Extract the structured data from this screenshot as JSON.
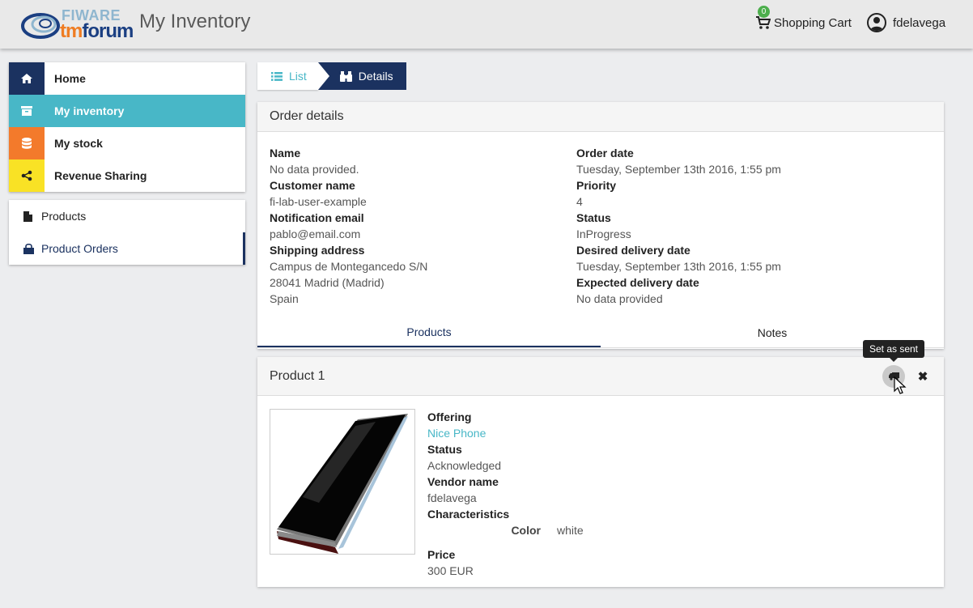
{
  "header": {
    "logo_line1": "FIWARE",
    "logo_line2_a": "tm",
    "logo_line2_b": "forum",
    "app_title": "My Inventory",
    "cart_label": "Shopping Cart",
    "cart_count": "0",
    "username": "fdelavega"
  },
  "sidebar": {
    "items": [
      {
        "label": "Home",
        "icon": "home-icon",
        "color": "#1b3260"
      },
      {
        "label": "My inventory",
        "icon": "archive-icon",
        "color": "#48b7c7"
      },
      {
        "label": "My stock",
        "icon": "database-icon",
        "color": "#f37a2b"
      },
      {
        "label": "Revenue Sharing",
        "icon": "share-icon",
        "color": "#f9e225"
      }
    ],
    "subitems": [
      {
        "label": "Products",
        "icon": "file-icon"
      },
      {
        "label": "Product Orders",
        "icon": "shopping-bag-icon"
      }
    ]
  },
  "breadcrumb": {
    "list_label": "List",
    "details_label": "Details"
  },
  "order": {
    "title": "Order details",
    "name_label": "Name",
    "name_value": "No data provided.",
    "customer_label": "Customer name",
    "customer_value": "fi-lab-user-example",
    "email_label": "Notification email",
    "email_value": "pablo@email.com",
    "shipping_label": "Shipping address",
    "shipping_line1": "Campus de Montegancedo S/N",
    "shipping_line2": "28041 Madrid (Madrid)",
    "shipping_line3": "Spain",
    "order_date_label": "Order date",
    "order_date_value": "Tuesday, September 13th 2016, 1:55 pm",
    "priority_label": "Priority",
    "priority_value": "4",
    "status_label": "Status",
    "status_value": "InProgress",
    "desired_label": "Desired delivery date",
    "desired_value": "Tuesday, September 13th 2016, 1:55 pm",
    "expected_label": "Expected delivery date",
    "expected_value": "No data provided",
    "tabs": [
      "Products",
      "Notes"
    ]
  },
  "product": {
    "title": "Product 1",
    "tooltip": "Set as sent",
    "offering_label": "Offering",
    "offering_value": "Nice Phone",
    "status_label": "Status",
    "status_value": "Acknowledged",
    "vendor_label": "Vendor name",
    "vendor_value": "fdelavega",
    "characteristics_label": "Characteristics",
    "char_key": "Color",
    "char_value": "white",
    "price_label": "Price",
    "price_value": "300 EUR"
  }
}
